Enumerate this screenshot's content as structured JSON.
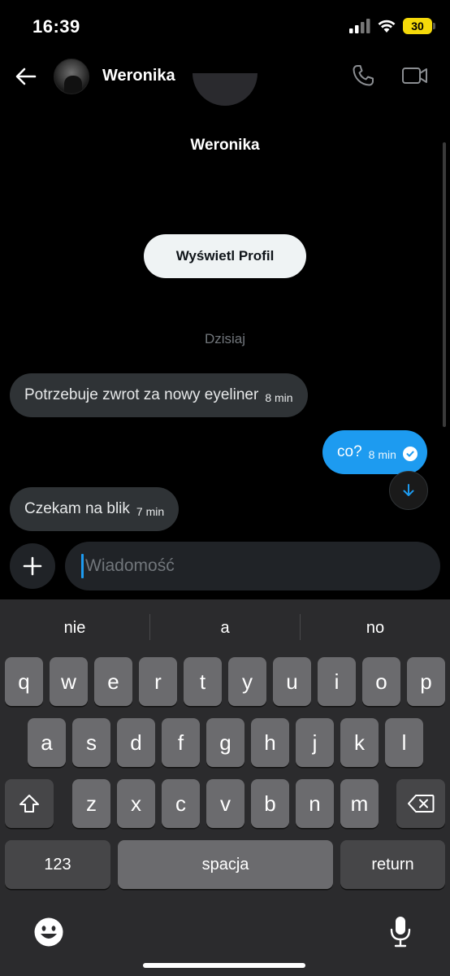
{
  "status_bar": {
    "time": "16:39",
    "battery": "30"
  },
  "header": {
    "contact_name": "Weronika"
  },
  "profile": {
    "name": "Weronika",
    "view_profile_label": "Wyświetl Profil"
  },
  "date_separator": "Dzisiaj",
  "messages": [
    {
      "direction": "incoming",
      "text": "Potrzebuje zwrot za nowy eyeliner",
      "time": "8 min"
    },
    {
      "direction": "outgoing",
      "text": "co?",
      "time": "8 min",
      "status": "read"
    },
    {
      "direction": "incoming",
      "text": "Czekam na blik",
      "time": "7 min"
    }
  ],
  "composer": {
    "placeholder": "Wiadomość"
  },
  "keyboard": {
    "suggestions": [
      "nie",
      "a",
      "no"
    ],
    "row1": [
      "q",
      "w",
      "e",
      "r",
      "t",
      "y",
      "u",
      "i",
      "o",
      "p"
    ],
    "row2": [
      "a",
      "s",
      "d",
      "f",
      "g",
      "h",
      "j",
      "k",
      "l"
    ],
    "row3": [
      "z",
      "x",
      "c",
      "v",
      "b",
      "n",
      "m"
    ],
    "numbers_label": "123",
    "space_label": "spacja",
    "return_label": "return"
  },
  "colors": {
    "accent": "#1d9bf0",
    "incoming_bubble": "#2f3336",
    "background": "#000000"
  }
}
